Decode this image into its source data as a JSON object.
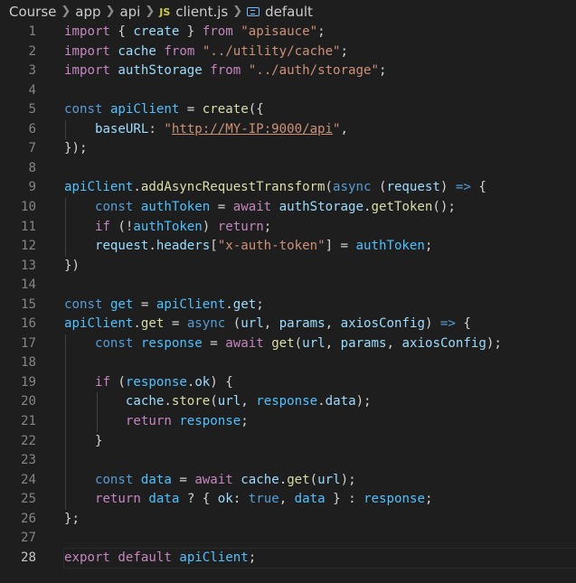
{
  "breadcrumb": {
    "items": [
      "Course",
      "app",
      "api",
      "client.js",
      "default"
    ],
    "file_icon_label": "JS"
  },
  "colors": {
    "background": "#1e1e1e",
    "keyword_control": "#c586c0",
    "keyword_storage": "#569cd6",
    "function": "#dcdcaa",
    "variable": "#9cdcfe",
    "constant": "#4fc1ff",
    "string": "#ce9178",
    "punctuation": "#d4d4d4",
    "line_number": "#858585"
  },
  "editor": {
    "current_line": 28,
    "lines": [
      {
        "n": "1",
        "tokens": [
          [
            "kw",
            "import"
          ],
          [
            "pn",
            " { "
          ],
          [
            "vr",
            "create"
          ],
          [
            "pn",
            " } "
          ],
          [
            "kw",
            "from"
          ],
          [
            "pn",
            " "
          ],
          [
            "str",
            "\"apisauce\""
          ],
          [
            "pn",
            ";"
          ]
        ]
      },
      {
        "n": "2",
        "tokens": [
          [
            "kw",
            "import"
          ],
          [
            "pn",
            " "
          ],
          [
            "vr",
            "cache"
          ],
          [
            "pn",
            " "
          ],
          [
            "kw",
            "from"
          ],
          [
            "pn",
            " "
          ],
          [
            "str",
            "\"../utility/cache\""
          ],
          [
            "pn",
            ";"
          ]
        ]
      },
      {
        "n": "3",
        "tokens": [
          [
            "kw",
            "import"
          ],
          [
            "pn",
            " "
          ],
          [
            "vr",
            "authStorage"
          ],
          [
            "pn",
            " "
          ],
          [
            "kw",
            "from"
          ],
          [
            "pn",
            " "
          ],
          [
            "str",
            "\"../auth/storage\""
          ],
          [
            "pn",
            ";"
          ]
        ]
      },
      {
        "n": "4",
        "tokens": []
      },
      {
        "n": "5",
        "tokens": [
          [
            "st",
            "const"
          ],
          [
            "pn",
            " "
          ],
          [
            "cn",
            "apiClient"
          ],
          [
            "pn",
            " = "
          ],
          [
            "fn",
            "create"
          ],
          [
            "pn",
            "({"
          ]
        ]
      },
      {
        "n": "6",
        "tokens": [
          [
            "pn",
            "    "
          ],
          [
            "vr",
            "baseURL"
          ],
          [
            "pn",
            ": "
          ],
          [
            "str",
            "\""
          ],
          [
            "url",
            "http://MY-IP:9000/api"
          ],
          [
            "str",
            "\""
          ],
          [
            "pn",
            ","
          ]
        ]
      },
      {
        "n": "7",
        "tokens": [
          [
            "pn",
            "});"
          ]
        ]
      },
      {
        "n": "8",
        "tokens": []
      },
      {
        "n": "9",
        "tokens": [
          [
            "cn",
            "apiClient"
          ],
          [
            "pn",
            "."
          ],
          [
            "fn",
            "addAsyncRequestTransform"
          ],
          [
            "pn",
            "("
          ],
          [
            "st",
            "async"
          ],
          [
            "pn",
            " ("
          ],
          [
            "vr",
            "request"
          ],
          [
            "pn",
            ") "
          ],
          [
            "st",
            "=>"
          ],
          [
            "pn",
            " {"
          ]
        ]
      },
      {
        "n": "10",
        "tokens": [
          [
            "pn",
            "    "
          ],
          [
            "st",
            "const"
          ],
          [
            "pn",
            " "
          ],
          [
            "cn",
            "authToken"
          ],
          [
            "pn",
            " = "
          ],
          [
            "kw",
            "await"
          ],
          [
            "pn",
            " "
          ],
          [
            "vr",
            "authStorage"
          ],
          [
            "pn",
            "."
          ],
          [
            "fn",
            "getToken"
          ],
          [
            "pn",
            "();"
          ]
        ]
      },
      {
        "n": "11",
        "tokens": [
          [
            "pn",
            "    "
          ],
          [
            "kw",
            "if"
          ],
          [
            "pn",
            " (!"
          ],
          [
            "cn",
            "authToken"
          ],
          [
            "pn",
            ") "
          ],
          [
            "kw",
            "return"
          ],
          [
            "pn",
            ";"
          ]
        ]
      },
      {
        "n": "12",
        "tokens": [
          [
            "pn",
            "    "
          ],
          [
            "vr",
            "request"
          ],
          [
            "pn",
            "."
          ],
          [
            "vr",
            "headers"
          ],
          [
            "pn",
            "["
          ],
          [
            "str",
            "\"x-auth-token\""
          ],
          [
            "pn",
            "] = "
          ],
          [
            "cn",
            "authToken"
          ],
          [
            "pn",
            ";"
          ]
        ]
      },
      {
        "n": "13",
        "tokens": [
          [
            "pn",
            "})"
          ]
        ]
      },
      {
        "n": "14",
        "tokens": []
      },
      {
        "n": "15",
        "tokens": [
          [
            "st",
            "const"
          ],
          [
            "pn",
            " "
          ],
          [
            "cn",
            "get"
          ],
          [
            "pn",
            " = "
          ],
          [
            "cn",
            "apiClient"
          ],
          [
            "pn",
            "."
          ],
          [
            "vr",
            "get"
          ],
          [
            "pn",
            ";"
          ]
        ]
      },
      {
        "n": "16",
        "tokens": [
          [
            "cn",
            "apiClient"
          ],
          [
            "pn",
            "."
          ],
          [
            "fn",
            "get"
          ],
          [
            "pn",
            " = "
          ],
          [
            "st",
            "async"
          ],
          [
            "pn",
            " ("
          ],
          [
            "vr",
            "url"
          ],
          [
            "pn",
            ", "
          ],
          [
            "vr",
            "params"
          ],
          [
            "pn",
            ", "
          ],
          [
            "vr",
            "axiosConfig"
          ],
          [
            "pn",
            ") "
          ],
          [
            "st",
            "=>"
          ],
          [
            "pn",
            " {"
          ]
        ]
      },
      {
        "n": "17",
        "tokens": [
          [
            "pn",
            "    "
          ],
          [
            "st",
            "const"
          ],
          [
            "pn",
            " "
          ],
          [
            "cn",
            "response"
          ],
          [
            "pn",
            " = "
          ],
          [
            "kw",
            "await"
          ],
          [
            "pn",
            " "
          ],
          [
            "fn",
            "get"
          ],
          [
            "pn",
            "("
          ],
          [
            "vr",
            "url"
          ],
          [
            "pn",
            ", "
          ],
          [
            "vr",
            "params"
          ],
          [
            "pn",
            ", "
          ],
          [
            "vr",
            "axiosConfig"
          ],
          [
            "pn",
            ");"
          ]
        ]
      },
      {
        "n": "18",
        "tokens": []
      },
      {
        "n": "19",
        "tokens": [
          [
            "pn",
            "    "
          ],
          [
            "kw",
            "if"
          ],
          [
            "pn",
            " ("
          ],
          [
            "cn",
            "response"
          ],
          [
            "pn",
            "."
          ],
          [
            "vr",
            "ok"
          ],
          [
            "pn",
            ") {"
          ]
        ]
      },
      {
        "n": "20",
        "tokens": [
          [
            "pn",
            "        "
          ],
          [
            "vr",
            "cache"
          ],
          [
            "pn",
            "."
          ],
          [
            "fn",
            "store"
          ],
          [
            "pn",
            "("
          ],
          [
            "vr",
            "url"
          ],
          [
            "pn",
            ", "
          ],
          [
            "cn",
            "response"
          ],
          [
            "pn",
            "."
          ],
          [
            "vr",
            "data"
          ],
          [
            "pn",
            ");"
          ]
        ]
      },
      {
        "n": "21",
        "tokens": [
          [
            "pn",
            "        "
          ],
          [
            "kw",
            "return"
          ],
          [
            "pn",
            " "
          ],
          [
            "cn",
            "response"
          ],
          [
            "pn",
            ";"
          ]
        ]
      },
      {
        "n": "22",
        "tokens": [
          [
            "pn",
            "    }"
          ]
        ]
      },
      {
        "n": "23",
        "tokens": []
      },
      {
        "n": "24",
        "tokens": [
          [
            "pn",
            "    "
          ],
          [
            "st",
            "const"
          ],
          [
            "pn",
            " "
          ],
          [
            "cn",
            "data"
          ],
          [
            "pn",
            " = "
          ],
          [
            "kw",
            "await"
          ],
          [
            "pn",
            " "
          ],
          [
            "vr",
            "cache"
          ],
          [
            "pn",
            "."
          ],
          [
            "fn",
            "get"
          ],
          [
            "pn",
            "("
          ],
          [
            "vr",
            "url"
          ],
          [
            "pn",
            ");"
          ]
        ]
      },
      {
        "n": "25",
        "tokens": [
          [
            "pn",
            "    "
          ],
          [
            "kw",
            "return"
          ],
          [
            "pn",
            " "
          ],
          [
            "cn",
            "data"
          ],
          [
            "pn",
            " ? { "
          ],
          [
            "vr",
            "ok"
          ],
          [
            "pn",
            ": "
          ],
          [
            "st",
            "true"
          ],
          [
            "pn",
            ", "
          ],
          [
            "cn",
            "data"
          ],
          [
            "pn",
            " } : "
          ],
          [
            "cn",
            "response"
          ],
          [
            "pn",
            ";"
          ]
        ]
      },
      {
        "n": "26",
        "tokens": [
          [
            "pn",
            "};"
          ]
        ]
      },
      {
        "n": "27",
        "tokens": []
      },
      {
        "n": "28",
        "tokens": [
          [
            "kw",
            "export"
          ],
          [
            "pn",
            " "
          ],
          [
            "kw",
            "default"
          ],
          [
            "pn",
            " "
          ],
          [
            "cn",
            "apiClient"
          ],
          [
            "pn",
            ";"
          ]
        ]
      }
    ]
  }
}
